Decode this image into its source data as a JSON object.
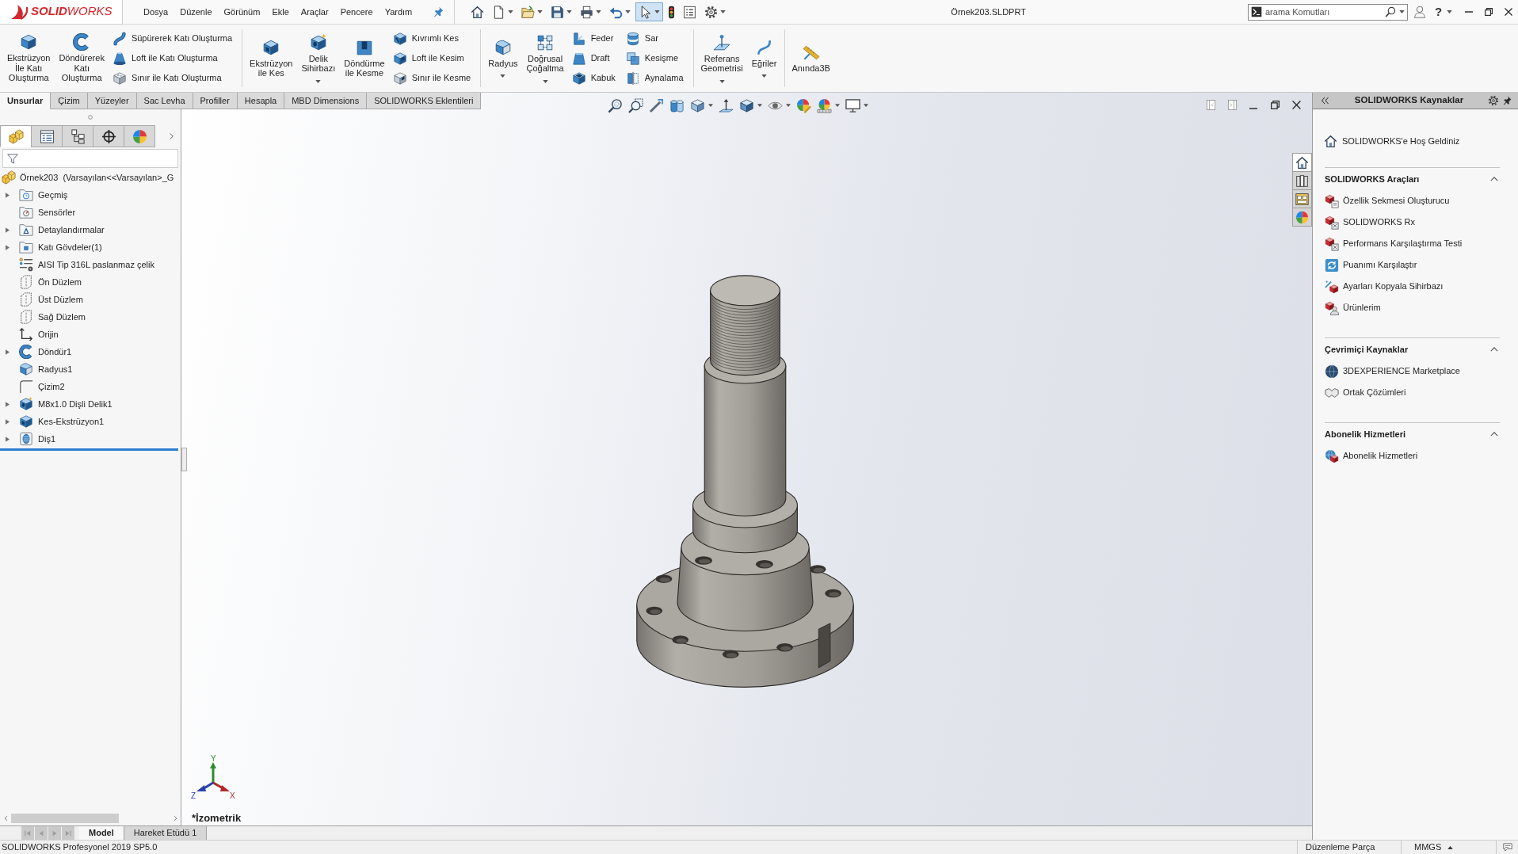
{
  "title_bar": {
    "logo": "**SOLID**WORKS",
    "menu": [
      "Dosya",
      "Düzenle",
      "Görünüm",
      "Ekle",
      "Araçlar",
      "Pencere",
      "Yardım"
    ],
    "quick_access": [
      {
        "dropdown": false,
        "pressed": false
      },
      {
        "dropdown": true,
        "pressed": false
      },
      {
        "dropdown": true,
        "pressed": false
      },
      {
        "dropdown": true,
        "pressed": false
      },
      {
        "dropdown": true,
        "pressed": false
      },
      {
        "dropdown": true,
        "pressed": false
      },
      {
        "dropdown": true,
        "pressed": true
      },
      {
        "dropdown": false,
        "pressed": false
      },
      {
        "dropdown": false,
        "pressed": false
      },
      {
        "dropdown": true,
        "pressed": false
      }
    ],
    "document_title": "Örnek203.SLDPRT",
    "search": {
      "placeholder": "arama Komutları"
    },
    "help": "?"
  },
  "ribbon": {
    "groups": [
      {
        "items": [
          {
            "kind": "large",
            "label": "Ekstrüzyon\nİle Katı\nOluşturma",
            "dropdown": false
          },
          {
            "kind": "large",
            "label": "Döndürerek\nKatı\nOluşturma",
            "dropdown": false
          },
          {
            "kind": "column",
            "buttons": [
              "Süpürerek Katı Oluşturma",
              "Loft ile Katı Oluşturma",
              "Sınır ile Katı Oluşturma"
            ]
          }
        ]
      },
      {
        "items": [
          {
            "kind": "large",
            "label": "Ekstrüzyon\nile Kes",
            "dropdown": false
          },
          {
            "kind": "large",
            "label": "Delik\nSihirbazı",
            "dropdown": true
          },
          {
            "kind": "large",
            "label": "Döndürme\nile Kesme",
            "dropdown": false
          },
          {
            "kind": "column",
            "buttons": [
              "Kıvrımlı Kes",
              "Loft ile Kesim",
              "Sınır ile Kesme"
            ]
          }
        ]
      },
      {
        "items": [
          {
            "kind": "large",
            "label": "Radyus",
            "dropdown": true
          },
          {
            "kind": "large",
            "label": "Doğrusal\nÇoğaltma",
            "dropdown": true
          },
          {
            "kind": "column",
            "buttons": [
              "Feder",
              "Draft",
              "Kabuk"
            ]
          },
          {
            "kind": "column",
            "buttons": [
              "Sar",
              "Kesişme",
              "Aynalama"
            ]
          }
        ]
      },
      {
        "items": [
          {
            "kind": "large",
            "label": "Referans\nGeometrisi",
            "dropdown": true
          },
          {
            "kind": "large",
            "label": "Eğriler",
            "dropdown": true
          }
        ]
      },
      {
        "items": [
          {
            "kind": "large",
            "label": "Anında3B",
            "dropdown": false
          }
        ]
      }
    ]
  },
  "command_tabs": [
    {
      "label": "Unsurlar",
      "selected": true
    },
    {
      "label": "Çizim",
      "selected": false
    },
    {
      "label": "Yüzeyler",
      "selected": false
    },
    {
      "label": "Sac Levha",
      "selected": false
    },
    {
      "label": "Profiller",
      "selected": false
    },
    {
      "label": "Hesapla",
      "selected": false
    },
    {
      "label": "MBD Dimensions",
      "selected": false
    },
    {
      "label": "SOLIDWORKS Eklentileri",
      "selected": false
    }
  ],
  "feature_manager": {
    "tabs": [
      {
        "selected": true
      },
      {
        "selected": false
      },
      {
        "selected": false
      },
      {
        "selected": false
      },
      {
        "selected": false
      }
    ],
    "root": "Örnek203  (Varsayılan<<Varsayılan>_G",
    "items": [
      {
        "label": "Geçmiş",
        "kind": "history",
        "expandable": true
      },
      {
        "label": "Sensörler",
        "kind": "sensors",
        "expandable": false
      },
      {
        "label": "Detaylandırmalar",
        "kind": "annotations",
        "expandable": true
      },
      {
        "label": "Katı Gövdeler(1)",
        "kind": "bodies",
        "expandable": true
      },
      {
        "label": "AISI Tip 316L paslanmaz çelik",
        "kind": "material",
        "expandable": false
      },
      {
        "label": "Ön Düzlem",
        "kind": "plane",
        "expandable": false
      },
      {
        "label": "Üst Düzlem",
        "kind": "plane",
        "expandable": false
      },
      {
        "label": "Sağ Düzlem",
        "kind": "plane",
        "expandable": false
      },
      {
        "label": "Orijin",
        "kind": "origin",
        "expandable": false
      },
      {
        "label": "Döndür1",
        "kind": "revolve",
        "expandable": true
      },
      {
        "label": "Radyus1",
        "kind": "fillet",
        "expandable": false
      },
      {
        "label": "Çizim2",
        "kind": "sketch",
        "expandable": false
      },
      {
        "label": "M8x1.0 Dişli Delik1",
        "kind": "hole",
        "expandable": true
      },
      {
        "label": "Kes-Ekstrüzyon1",
        "kind": "cut",
        "expandable": true
      },
      {
        "label": "Diş1",
        "kind": "thread",
        "expandable": true
      }
    ]
  },
  "viewport": {
    "view_toolbar": [
      {
        "dropdown": false
      },
      {
        "dropdown": false
      },
      {
        "dropdown": false
      },
      {
        "dropdown": false
      },
      {
        "dropdown": true
      },
      {
        "dropdown": false
      },
      {
        "dropdown": true
      },
      {
        "dropdown": true
      },
      {
        "dropdown": false
      },
      {
        "dropdown": true
      },
      {
        "dropdown": true
      }
    ],
    "task_tabs": [
      {
        "selected": true
      },
      {
        "selected": false
      },
      {
        "selected": false
      },
      {
        "selected": false
      }
    ],
    "triad": {
      "x": "X",
      "y": "Y",
      "z": "Z"
    },
    "view_label": "*İzometrik"
  },
  "task_pane": {
    "title": "SOLIDWORKS Kaynaklar",
    "welcome": "SOLIDWORKS'e Hoş Geldiniz",
    "sections": [
      {
        "title": "SOLIDWORKS Araçları",
        "expanded": true,
        "items": [
          {
            "label": "Özellik Sekmesi Oluşturucu",
            "kind": "builder"
          },
          {
            "label": "SOLIDWORKS Rx",
            "kind": "rx"
          },
          {
            "label": "Performans Karşılaştırma Testi",
            "kind": "benchmark"
          },
          {
            "label": "Puanımı Karşılaştır",
            "kind": "compare"
          },
          {
            "label": "Ayarları Kopyala Sihirbazı",
            "kind": "wizard"
          },
          {
            "label": "Ürünlerim",
            "kind": "products"
          }
        ]
      },
      {
        "title": "Çevrimiçi Kaynaklar",
        "expanded": true,
        "items": [
          {
            "label": "3DEXPERIENCE Marketplace",
            "kind": "marketplace"
          },
          {
            "label": "Ortak Çözümleri",
            "kind": "partners"
          }
        ]
      },
      {
        "title": "Abonelik Hizmetleri",
        "expanded": true,
        "items": [
          {
            "label": "Abonelik Hizmetleri",
            "kind": "subscription"
          }
        ]
      }
    ]
  },
  "bottom_bar": {
    "scroll_buttons": [
      {
        "disabled": true
      },
      {
        "disabled": true
      },
      {
        "disabled": true
      },
      {
        "disabled": true
      }
    ],
    "tabs": [
      {
        "label": "Model",
        "selected": true
      },
      {
        "label": "Hareket Etüdü 1",
        "selected": false
      }
    ]
  },
  "status_bar": {
    "version": "SOLIDWORKS Profesyonel 2019 SP5.0",
    "mode": "Düzenleme Parça",
    "units": "MMGS"
  }
}
